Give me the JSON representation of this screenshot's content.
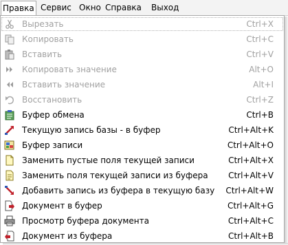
{
  "menubar": {
    "items": [
      "Правка",
      "Сервис",
      "Окно",
      "Справка",
      "Выход"
    ]
  },
  "menu": {
    "items": [
      {
        "label": "Вырезать",
        "shortcut": "Ctrl+X",
        "disabled": true,
        "icon": "scissors-icon"
      },
      {
        "label": "Копировать",
        "shortcut": "Ctrl+C",
        "disabled": true,
        "icon": "copy-icon"
      },
      {
        "label": "Вставить",
        "shortcut": "Ctrl+V",
        "disabled": true,
        "icon": "paste-icon"
      },
      {
        "label": "Копировать значение",
        "shortcut": "Alt+O",
        "disabled": true,
        "icon": "double-right-icon"
      },
      {
        "label": "Вставить значение",
        "shortcut": "Alt+I",
        "disabled": true,
        "icon": "double-left-icon"
      },
      {
        "label": "Восстановить",
        "shortcut": "Ctrl+Z",
        "disabled": true,
        "icon": "undo-icon"
      },
      {
        "label": "Буфер обмена",
        "shortcut": "Ctrl+B",
        "disabled": false,
        "icon": "clipboard-icon"
      },
      {
        "label": "Текущую запись базы - в буфер",
        "shortcut": "Ctrl+Alt+K",
        "disabled": false,
        "icon": "arrow-to-buffer-icon"
      },
      {
        "label": "Буфер записи",
        "shortcut": "Ctrl+Alt+O",
        "disabled": false,
        "icon": "record-buffer-icon"
      },
      {
        "label": "Заменить пустые поля текущей записи",
        "shortcut": "Ctrl+Alt+X",
        "disabled": false,
        "icon": "page-icon"
      },
      {
        "label": "Заменить поля  текущей записи из буфера",
        "shortcut": "Ctrl+Alt+V",
        "disabled": false,
        "icon": "page-edit-icon"
      },
      {
        "label": "Добавить запись из буфера в текущую базу",
        "shortcut": "Ctrl+Alt+W",
        "disabled": false,
        "icon": "arrow-from-buffer-icon"
      },
      {
        "label": "Документ в буфер",
        "shortcut": "Ctrl+Alt+G",
        "disabled": false,
        "icon": "document-to-buffer-icon"
      },
      {
        "label": "Просмотр буфера документа",
        "shortcut": "Ctrl+Alt+C",
        "disabled": false,
        "icon": "printer-view-icon"
      },
      {
        "label": "Документ из буфера",
        "shortcut": "Ctrl+Alt+B",
        "disabled": false,
        "icon": "document-from-buffer-icon"
      }
    ]
  }
}
